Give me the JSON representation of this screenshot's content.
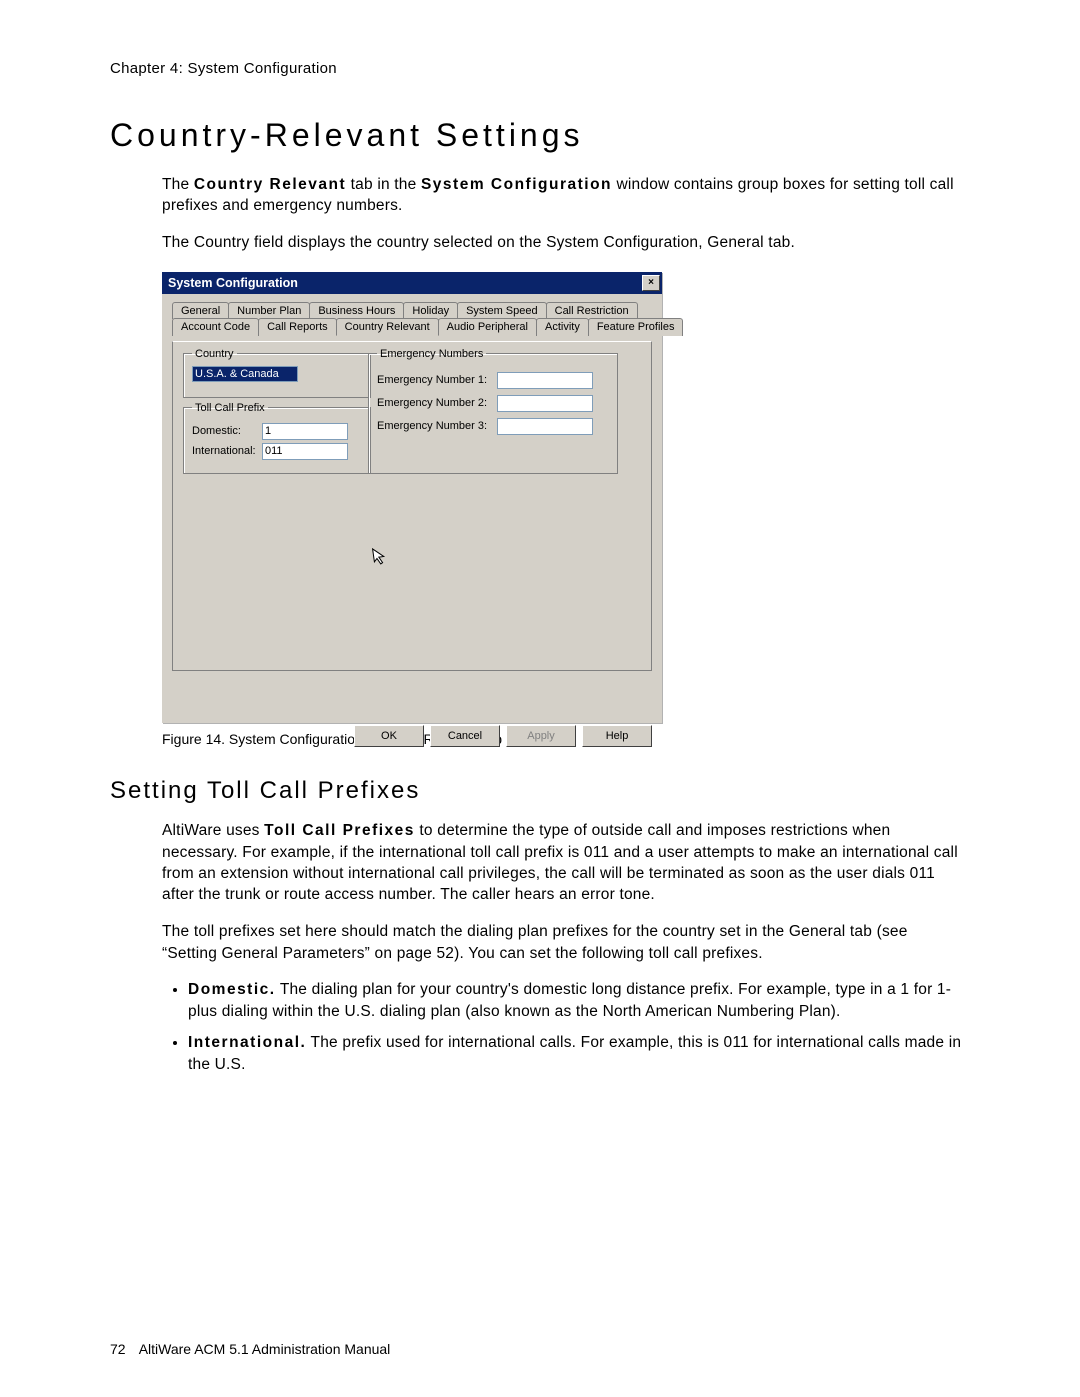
{
  "chapter_line": "Chapter 4:  System Configuration",
  "section_title": "Country-Relevant Settings",
  "para1_a": "The ",
  "para1_b": "Country Relevant",
  "para1_c": " tab in the ",
  "para1_d": "System Configuration",
  "para1_e": " window contains group boxes for setting toll call prefixes and emergency numbers.",
  "para2": "The Country field displays the country selected on the System Configuration, General tab.",
  "dialog": {
    "title": "System Configuration",
    "close": "×",
    "tabs_row1": [
      "General",
      "Number Plan",
      "Business Hours",
      "Holiday",
      "System Speed",
      "Call Restriction"
    ],
    "tabs_row2": [
      "Account Code",
      "Call Reports",
      "Country Relevant",
      "Audio Peripheral",
      "Activity",
      "Feature Profiles"
    ],
    "active_tab": "Country Relevant",
    "country_legend": "Country",
    "country_value": "U.S.A. & Canada",
    "toll_legend": "Toll Call Prefix",
    "domestic_label": "Domestic:",
    "domestic_value": "1",
    "intl_label": "International:",
    "intl_value": "011",
    "emerg_legend": "Emergency Numbers",
    "en1_label": "Emergency Number 1:",
    "en2_label": "Emergency Number 2:",
    "en3_label": "Emergency Number 3:",
    "en1_value": "",
    "en2_value": "",
    "en3_value": "",
    "ok": "OK",
    "cancel": "Cancel",
    "apply": "Apply",
    "help": "Help"
  },
  "figure_caption": "Figure 14.   System Configuration, Country Relevant tab",
  "subsection_title": "Setting Toll Call Prefixes",
  "p3_a": "AltiWare uses ",
  "p3_b": "Toll Call Prefixes",
  "p3_c": " to determine the type of outside call and imposes restrictions when necessary. For example, if the international toll call prefix is 011 and a user attempts to make an international call from an extension without international call privileges, the call will be terminated as soon as the user dials 011 after the trunk or route access number. The caller hears an error tone.",
  "p4": "The toll prefixes set here should match the dialing plan prefixes for the country set in the General tab (see “Setting General Parameters” on page 52). You can set the following toll call prefixes.",
  "bullets": [
    {
      "b": "Domestic.",
      "t": " The dialing plan for your country's domestic long distance prefix. For example, type in a 1 for 1-plus dialing within the U.S. dialing plan (also known as the North American Numbering Plan)."
    },
    {
      "b": "International.",
      "t": " The prefix used for international calls. For example, this is 011 for international calls made in the U.S."
    }
  ],
  "footer_page": "72",
  "footer_text": "AltiWare ACM 5.1 Administration Manual"
}
